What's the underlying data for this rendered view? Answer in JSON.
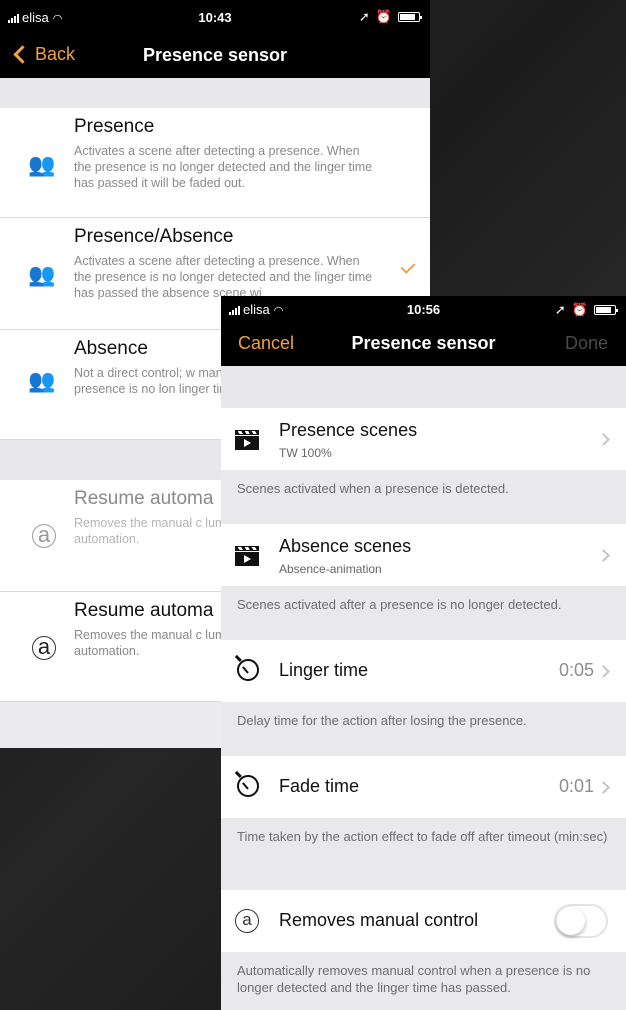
{
  "screen1": {
    "status": {
      "carrier": "elisa",
      "time": "10:43"
    },
    "nav": {
      "back_label": "Back",
      "title": "Presence sensor"
    },
    "modes": [
      {
        "title": "Presence",
        "description": "Activates a scene after detecting a presence. When the presence is no longer detected and the linger time has passed it will be faded out.",
        "selected": false,
        "icon": "presence-icon"
      },
      {
        "title": "Presence/Absence",
        "description": "Activates a scene after detecting a presence. When the presence is no longer detected and the linger time has passed the absence scene wi",
        "selected": true,
        "icon": "presence-absence-icon"
      },
      {
        "title": "Absence",
        "description": "Not a direct control; w manual control on affe the presence is no lon linger time has passed",
        "selected": false,
        "icon": "absence-icon"
      }
    ],
    "resume": [
      {
        "title": "Resume automa",
        "description": "Removes the manual c luminaires and resume automation.",
        "icon": "auto-icon"
      },
      {
        "title": "Resume automa",
        "description": "Removes the manual c luminaires and resume automation.",
        "icon": "auto-icon"
      }
    ]
  },
  "screen2": {
    "status": {
      "carrier": "elisa",
      "time": "10:56"
    },
    "nav": {
      "cancel_label": "Cancel",
      "title": "Presence sensor",
      "done_label": "Done"
    },
    "presence_scenes": {
      "title": "Presence scenes",
      "subtitle": "TW 100%",
      "note": "Scenes activated when a presence is detected."
    },
    "absence_scenes": {
      "title": "Absence scenes",
      "subtitle": "Absence-animation",
      "note": "Scenes activated after a presence is no longer detected."
    },
    "linger_time": {
      "title": "Linger time",
      "value": "0:05",
      "note": "Delay time for the action after losing the presence."
    },
    "fade_time": {
      "title": "Fade time",
      "value": "0:01",
      "note": "Time taken by the action effect to fade off after timeout (min:sec)"
    },
    "manual_control": {
      "title": "Removes manual control",
      "enabled": false,
      "note": "Automatically removes manual control when a presence is no longer detected and the linger time has passed."
    }
  },
  "colors": {
    "accent": "#f3a23c",
    "background": "#1e1e1e"
  }
}
